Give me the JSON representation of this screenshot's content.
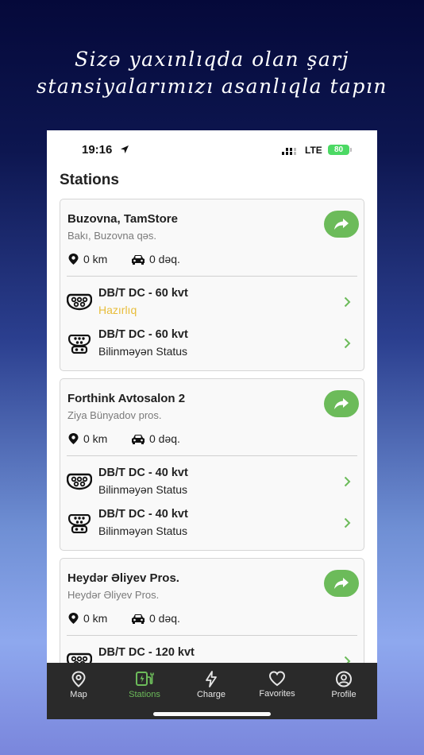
{
  "headline": {
    "line1": "Sizə yaxınlıqda olan şarj",
    "line2": "stansiyalarımızı asanlıqla tapın"
  },
  "status_bar": {
    "time": "19:16",
    "network": "LTE",
    "battery": "80"
  },
  "page_title": "Stations",
  "stations": [
    {
      "name": "Buzovna, TamStore",
      "address": "Bakı, Buzovna qəs.",
      "distance": "0 km",
      "drive_time": "0 dəq.",
      "connectors": [
        {
          "title": "DB/T DC - 60 kvt",
          "status": "Hazırlıq",
          "icon": "connector-type2-icon"
        },
        {
          "title": "DB/T DC - 60 kvt",
          "status": "Bilinməyən Status",
          "icon": "connector-ccs-icon"
        }
      ]
    },
    {
      "name": "Forthink Avtosalon 2",
      "address": "Ziya Bünyadov pros.",
      "distance": "0 km",
      "drive_time": "0 dəq.",
      "connectors": [
        {
          "title": "DB/T DC - 40 kvt",
          "status": "Bilinməyən Status",
          "icon": "connector-type2-icon"
        },
        {
          "title": "DB/T DC - 40 kvt",
          "status": "Bilinməyən Status",
          "icon": "connector-ccs-icon"
        }
      ]
    },
    {
      "name": "Heydər Əliyev Pros.",
      "address": "Heydər Əliyev Pros.",
      "distance": "0 km",
      "drive_time": "0 dəq.",
      "connectors": [
        {
          "title": "DB/T DC - 120 kvt",
          "status": "",
          "icon": "connector-type2-icon"
        }
      ]
    }
  ],
  "tabs": [
    {
      "label": "Map",
      "icon": "map-pin-icon"
    },
    {
      "label": "Stations",
      "icon": "charging-station-icon",
      "active": true
    },
    {
      "label": "Charge",
      "icon": "lightning-icon"
    },
    {
      "label": "Favorites",
      "icon": "heart-icon"
    },
    {
      "label": "Profile",
      "icon": "profile-icon"
    }
  ],
  "colors": {
    "accent": "#6cbb5a",
    "status_ready": "#e8bd3a",
    "tabbar": "#2a2a2a",
    "battery": "#4cd964"
  }
}
